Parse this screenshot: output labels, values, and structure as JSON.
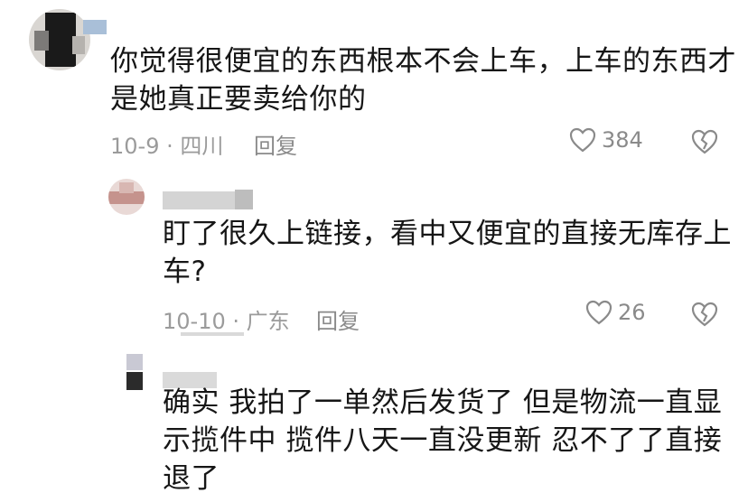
{
  "comments": [
    {
      "text_line1": "你觉得很便宜的东西根本不会上车，上车的东西才",
      "text_line2": "是她真正要卖给你的",
      "date_location": "10-9 · 四川",
      "reply_label": "回复",
      "likes": "384"
    },
    {
      "text_line1": "盯了很久上链接，看中又便宜的直接无库存上",
      "text_line2": "车?",
      "date_location": "10-10 · 广东",
      "reply_label": "回复",
      "likes": "26"
    },
    {
      "text_line1": "确实 我拍了一单然后发货了 但是物流一直显",
      "text_line2": "示揽件中 揽件八天一直没更新 忍不了了直接",
      "text_line3": "退了"
    }
  ],
  "icons": {
    "like": "heart-outline-icon",
    "dislike": "broken-heart-icon"
  },
  "colors": {
    "text": "#161616",
    "meta": "#9b9b9b",
    "icon": "#8a8a8a"
  }
}
